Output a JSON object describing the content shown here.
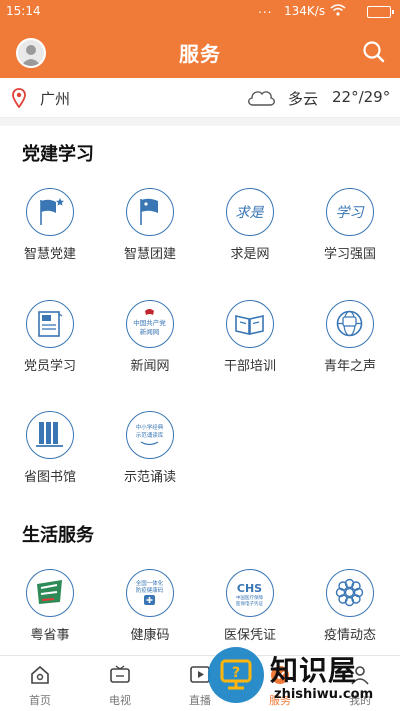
{
  "status_bar": {
    "time": "15:14",
    "dots": "...",
    "network_speed": "134K/s"
  },
  "header": {
    "title": "服务"
  },
  "location": {
    "city": "广州",
    "weather": "多云",
    "temperature": "22°/29°"
  },
  "sections": [
    {
      "title": "党建学习",
      "items": [
        {
          "label": "智慧党建",
          "icon": "flag-star-icon"
        },
        {
          "label": "智慧团建",
          "icon": "flag-icon"
        },
        {
          "label": "求是网",
          "icon": "qiushi-calligraphy-icon",
          "icon_text": "求是"
        },
        {
          "label": "学习强国",
          "icon": "xuexi-calligraphy-icon",
          "icon_text": "学习"
        },
        {
          "label": "党员学习",
          "icon": "flag-board-icon"
        },
        {
          "label": "新闻网",
          "icon": "party-emblem-news-icon",
          "icon_text": "中国共产党\n新闻网"
        },
        {
          "label": "干部培训",
          "icon": "open-book-icon"
        },
        {
          "label": "青年之声",
          "icon": "globe-speech-icon"
        },
        {
          "label": "省图书馆",
          "icon": "bookshelf-icon"
        },
        {
          "label": "示范诵读",
          "icon": "reading-badge-icon",
          "icon_text": "中小学经典\n示范诵读库"
        }
      ]
    },
    {
      "title": "生活服务",
      "items": [
        {
          "label": "粤省事",
          "icon": "yueshengshi-icon"
        },
        {
          "label": "健康码",
          "icon": "health-code-icon",
          "icon_text": "全国一体化\n防疫健康码"
        },
        {
          "label": "医保凭证",
          "icon": "chs-medical-insurance-icon",
          "icon_text": "CHS"
        },
        {
          "label": "疫情动态",
          "icon": "flower-pattern-icon"
        }
      ]
    }
  ],
  "bottom_nav": [
    {
      "label": "首页",
      "icon": "home-icon"
    },
    {
      "label": "电视",
      "icon": "tv-icon"
    },
    {
      "label": "直播",
      "icon": "play-icon"
    },
    {
      "label": "服务",
      "icon": "service-icon",
      "active": true
    },
    {
      "label": "我的",
      "icon": "profile-icon"
    }
  ],
  "watermark": {
    "text": "知识屋",
    "url": "zhishiwu.com"
  },
  "colors": {
    "brand": "#f07a38",
    "icon_blue": "#3a76b4",
    "text": "#333333"
  }
}
